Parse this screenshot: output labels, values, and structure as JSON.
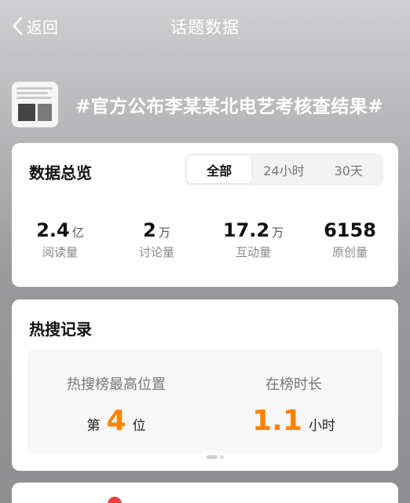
{
  "header": {
    "back_label": "返回",
    "title": "话题数据"
  },
  "topic": {
    "title": "#官方公布李某某北电艺考核查结果#"
  },
  "overview": {
    "title": "数据总览",
    "tabs": [
      "全部",
      "24小时",
      "30天"
    ],
    "active_tab": "全部",
    "stats": [
      {
        "value": "2.4",
        "unit": "亿",
        "label": "阅读量"
      },
      {
        "value": "2",
        "unit": "万",
        "label": "讨论量"
      },
      {
        "value": "17.2",
        "unit": "万",
        "label": "互动量"
      },
      {
        "value": "6158",
        "unit": "",
        "label": "原创量"
      }
    ]
  },
  "hot_search": {
    "title": "热搜记录",
    "highest": {
      "label": "热搜榜最高位置",
      "prefix": "第",
      "value": "4",
      "suffix": "位"
    },
    "duration": {
      "label": "在榜时长",
      "value": "1.1",
      "suffix": "小时"
    }
  },
  "colors": {
    "accent": "#ff8200",
    "card_bg": "#ffffff",
    "muted": "#888888"
  }
}
